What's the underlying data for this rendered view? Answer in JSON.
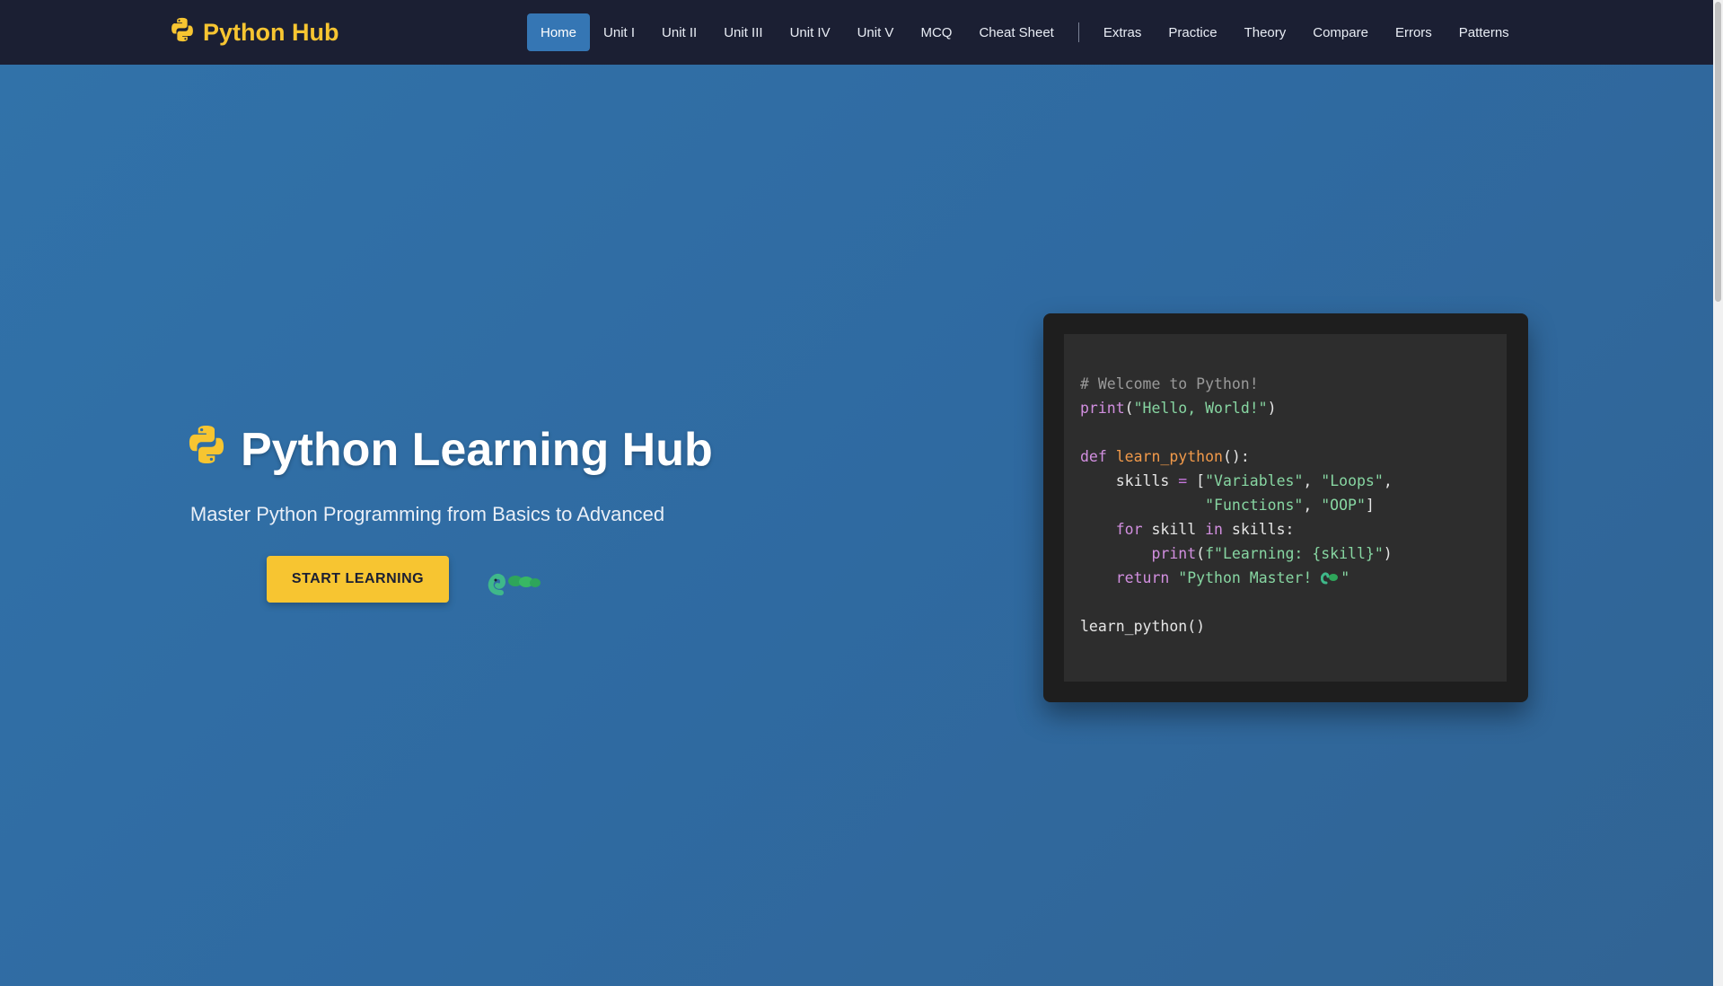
{
  "brand": {
    "name": "Python Hub",
    "icon": "python-logo-icon"
  },
  "nav": {
    "items": [
      {
        "label": "Home",
        "active": true
      },
      {
        "label": "Unit I"
      },
      {
        "label": "Unit II"
      },
      {
        "label": "Unit III"
      },
      {
        "label": "Unit IV"
      },
      {
        "label": "Unit V"
      },
      {
        "label": "MCQ"
      },
      {
        "label": "Cheat Sheet"
      }
    ],
    "extra_items": [
      {
        "label": "Extras"
      },
      {
        "label": "Practice"
      },
      {
        "label": "Theory"
      },
      {
        "label": "Compare"
      },
      {
        "label": "Errors"
      },
      {
        "label": "Patterns"
      }
    ]
  },
  "hero": {
    "title": "Python Learning Hub",
    "subtitle": "Master Python Programming from Basics to Advanced",
    "cta_label": "START LEARNING",
    "snake_icon": "snake-icon"
  },
  "code": {
    "comment": "# Welcome to Python!",
    "print_call": "print",
    "hello_string": "\"Hello, World!\"",
    "def_kw": "def",
    "func_name": "learn_python",
    "skills_var": "skills",
    "str_variables": "\"Variables\"",
    "str_loops": "\"Loops\"",
    "str_functions": "\"Functions\"",
    "str_oop": "\"OOP\"",
    "for_kw": "for",
    "skill_var": "skill",
    "in_kw": "in",
    "fstring": "f\"Learning: {skill}\"",
    "return_kw": "return",
    "return_string": "\"Python Master! ",
    "call_line": "learn_python()"
  },
  "colors": {
    "accent": "#f7c531",
    "navbar": "#1b1f33",
    "hero_bg": "#2f6aa3",
    "nav_active": "#3576b4",
    "code_bg": "#2d2d2d"
  }
}
